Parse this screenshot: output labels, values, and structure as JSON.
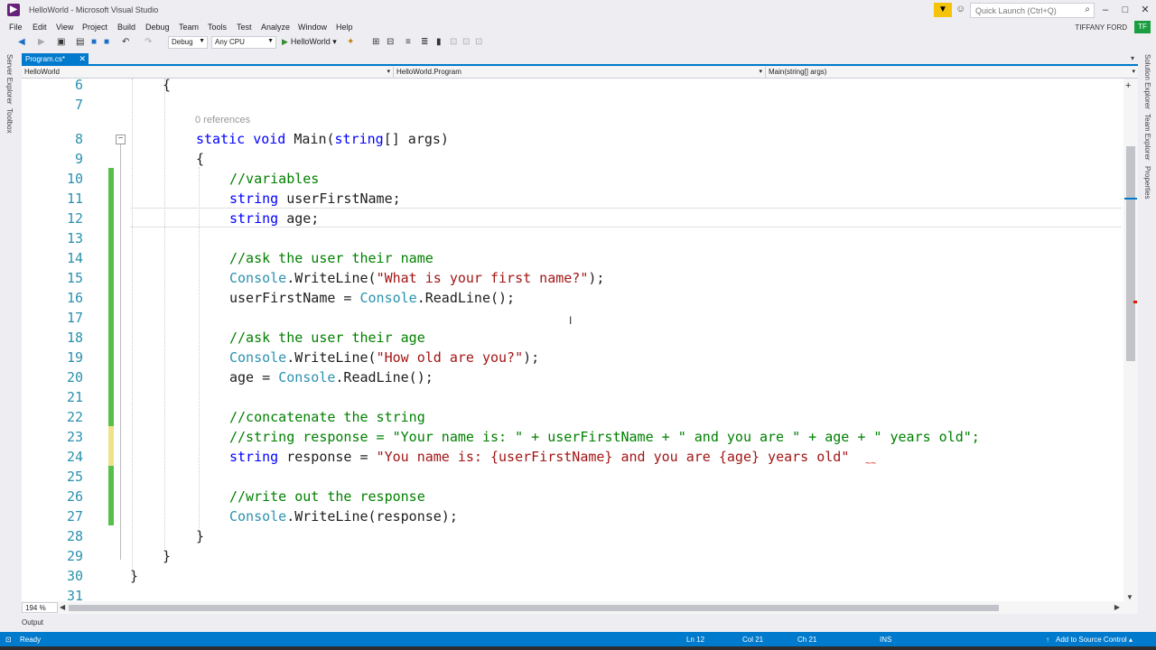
{
  "window": {
    "title": "HelloWorld - Microsoft Visual Studio"
  },
  "quick_launch": {
    "placeholder": "Quick Launch (Ctrl+Q)"
  },
  "menu": [
    "File",
    "Edit",
    "View",
    "Project",
    "Build",
    "Debug",
    "Team",
    "Tools",
    "Test",
    "Analyze",
    "Window",
    "Help"
  ],
  "user": {
    "name": "TIFFANY FORD",
    "initials": "TF"
  },
  "toolbar": {
    "config": "Debug",
    "platform": "Any CPU",
    "start_label": "HelloWorld"
  },
  "left_rail": {
    "server_explorer": "Server Explorer",
    "toolbox": "Toolbox"
  },
  "right_rail": {
    "solution_explorer": "Solution Explorer",
    "team_explorer": "Team Explorer",
    "properties": "Properties"
  },
  "document_tab": {
    "label": "Program.cs*"
  },
  "nav": {
    "project": "HelloWorld",
    "class": "HelloWorld.Program",
    "member": "Main(string[] args)"
  },
  "editor": {
    "codelens": "0 references",
    "line_numbers": [
      "6",
      "7",
      "8",
      "9",
      "10",
      "11",
      "12",
      "13",
      "14",
      "15",
      "16",
      "17",
      "18",
      "19",
      "20",
      "21",
      "22",
      "23",
      "24",
      "25",
      "26",
      "27",
      "28",
      "29",
      "30",
      "31"
    ],
    "lines": {
      "l10": "//variables",
      "l11_name": " userFirstName;",
      "l12_name": " age;",
      "l14": "//ask the user their name",
      "l15_str": "\"What is your first name?\"",
      "l16_a": "userFirstName = ",
      "l18": "//ask the user their age",
      "l19_str": "\"How old are you?\"",
      "l20_a": "age = ",
      "l22": "//concatenate the string",
      "l23": "//string response = \"Your name is: \" + userFirstName + \" and you are \" + age + \" years old\";",
      "l24_a": " response = ",
      "l24_str": "\"You name is: {userFirstName} and you are {age} years old\"",
      "l26": "//write out the response",
      "l27_arg": ".WriteLine(response);"
    },
    "keywords": {
      "static": "static",
      "void": "void",
      "string": "string",
      "main": " Main(",
      "args": "[] args)"
    },
    "types": {
      "console": "Console"
    },
    "calls": {
      "writeline_open": ".WriteLine(",
      "close": ");",
      "readline": ".ReadLine();"
    },
    "braces": {
      "open": "{",
      "close": "}"
    }
  },
  "zoom": "194 %",
  "panel": {
    "output": "Output"
  },
  "status": {
    "ready": "Ready",
    "ln": "Ln 12",
    "col": "Col 21",
    "ch": "Ch 21",
    "ins": "INS",
    "source_control": "Add to Source Control"
  },
  "colors": {
    "accent": "#007acc",
    "keyword": "#0000ff",
    "type": "#2b91af",
    "string": "#a31515",
    "comment": "#008000",
    "change_saved": "#57c04a",
    "change_unsaved": "#efe38a"
  }
}
